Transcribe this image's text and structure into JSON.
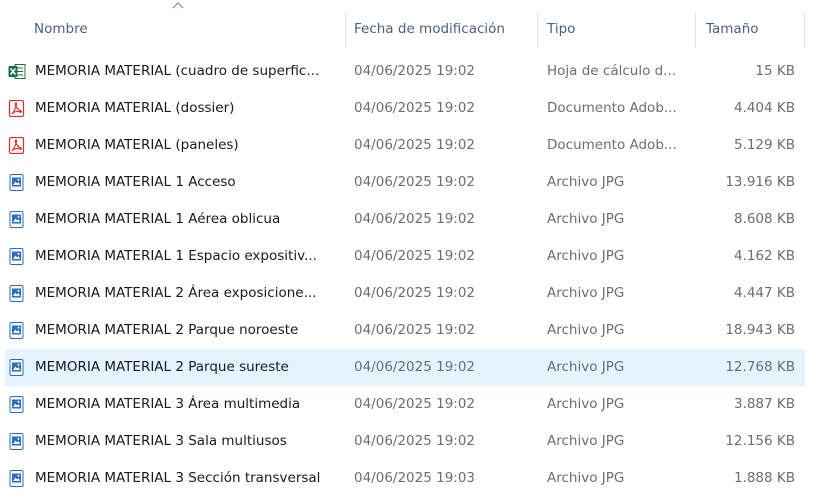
{
  "columns": {
    "name": "Nombre",
    "date": "Fecha de modificación",
    "type": "Tipo",
    "size": "Tamaño"
  },
  "files": [
    {
      "icon": "excel-file-icon",
      "name": "MEMORIA MATERIAL (cuadro de superfic...",
      "date": "04/06/2025 19:02",
      "type": "Hoja de cálculo d...",
      "size": "15 KB",
      "selected": false
    },
    {
      "icon": "pdf-file-icon",
      "name": "MEMORIA MATERIAL (dossier)",
      "date": "04/06/2025 19:02",
      "type": "Documento Adob...",
      "size": "4.404 KB",
      "selected": false
    },
    {
      "icon": "pdf-file-icon",
      "name": "MEMORIA MATERIAL (paneles)",
      "date": "04/06/2025 19:02",
      "type": "Documento Adob...",
      "size": "5.129 KB",
      "selected": false
    },
    {
      "icon": "jpg-file-icon",
      "name": "MEMORIA MATERIAL 1 Acceso",
      "date": "04/06/2025 19:02",
      "type": "Archivo JPG",
      "size": "13.916 KB",
      "selected": false
    },
    {
      "icon": "jpg-file-icon",
      "name": "MEMORIA MATERIAL 1 Aérea oblicua",
      "date": "04/06/2025 19:02",
      "type": "Archivo JPG",
      "size": "8.608 KB",
      "selected": false
    },
    {
      "icon": "jpg-file-icon",
      "name": "MEMORIA MATERIAL 1 Espacio expositiv...",
      "date": "04/06/2025 19:02",
      "type": "Archivo JPG",
      "size": "4.162 KB",
      "selected": false
    },
    {
      "icon": "jpg-file-icon",
      "name": "MEMORIA MATERIAL 2 Área exposicione...",
      "date": "04/06/2025 19:02",
      "type": "Archivo JPG",
      "size": "4.447 KB",
      "selected": false
    },
    {
      "icon": "jpg-file-icon",
      "name": "MEMORIA MATERIAL 2 Parque noroeste",
      "date": "04/06/2025 19:02",
      "type": "Archivo JPG",
      "size": "18.943 KB",
      "selected": false
    },
    {
      "icon": "jpg-file-icon",
      "name": "MEMORIA MATERIAL 2 Parque sureste",
      "date": "04/06/2025 19:02",
      "type": "Archivo JPG",
      "size": "12.768 KB",
      "selected": true
    },
    {
      "icon": "jpg-file-icon",
      "name": "MEMORIA MATERIAL 3 Área multimedia",
      "date": "04/06/2025 19:02",
      "type": "Archivo JPG",
      "size": "3.887 KB",
      "selected": false
    },
    {
      "icon": "jpg-file-icon",
      "name": "MEMORIA MATERIAL 3 Sala multiusos",
      "date": "04/06/2025 19:02",
      "type": "Archivo JPG",
      "size": "12.156 KB",
      "selected": false
    },
    {
      "icon": "jpg-file-icon",
      "name": "MEMORIA MATERIAL 3 Sección transversal",
      "date": "04/06/2025 19:03",
      "type": "Archivo JPG",
      "size": "1.888 KB",
      "selected": false
    }
  ],
  "colors": {
    "selected_row": "#e5f3ff",
    "excel_green": "#1d7044",
    "pdf_red": "#d9302c",
    "jpg_blue": "#2a6ebb"
  }
}
